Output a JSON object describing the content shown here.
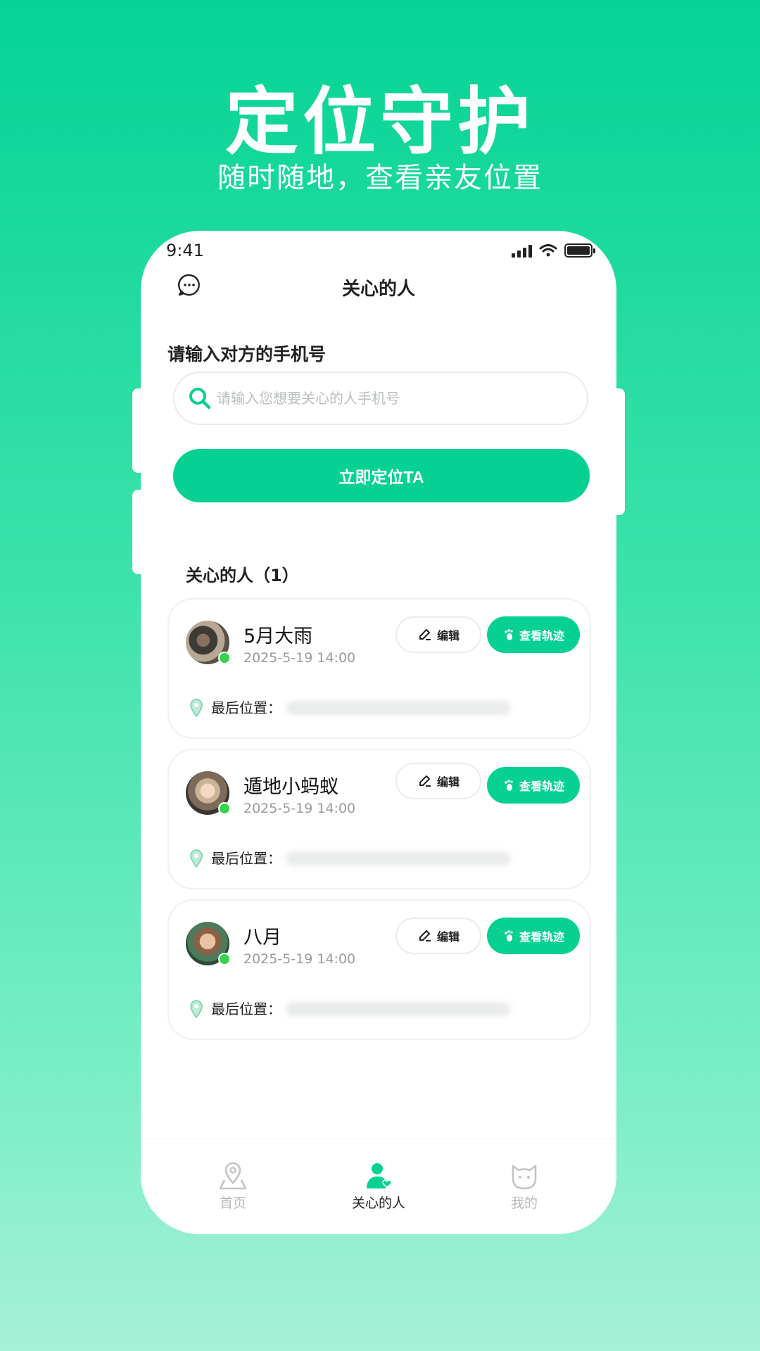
{
  "hero": {
    "title": "定位守护",
    "subtitle": "随时随地，查看亲友位置"
  },
  "status_bar": {
    "time": "9:41"
  },
  "nav": {
    "title": "关心的人",
    "message_icon": "chat-bubble-icon"
  },
  "search": {
    "label": "请输入对方的手机号",
    "placeholder": "请输入您想要关心的人手机号",
    "value": ""
  },
  "locate_button": "立即定位TA",
  "list": {
    "title": "关心的人（1）",
    "items": [
      {
        "name": "5月大雨",
        "time": "2025-5-19 14:00",
        "location_label": "最后位置：",
        "edit_label": "编辑",
        "track_label": "查看轨迹",
        "online": true
      },
      {
        "name": "遁地小蚂蚁",
        "time": "2025-5-19 14:00",
        "location_label": "最后位置：",
        "edit_label": "编辑",
        "track_label": "查看轨迹",
        "online": true
      },
      {
        "name": "八月",
        "time": "2025-5-19 14:00",
        "location_label": "最后位置：",
        "edit_label": "编辑",
        "track_label": "查看轨迹",
        "online": true
      }
    ]
  },
  "tabs": [
    {
      "label": "首页",
      "icon": "map-pin-icon",
      "active": false
    },
    {
      "label": "关心的人",
      "icon": "person-heart-icon",
      "active": true
    },
    {
      "label": "我的",
      "icon": "cat-face-icon",
      "active": false
    }
  ],
  "colors": {
    "accent": "#06d193",
    "online": "#35d24a",
    "background_top": "#05d394",
    "background_bottom": "#a6f0d8"
  }
}
